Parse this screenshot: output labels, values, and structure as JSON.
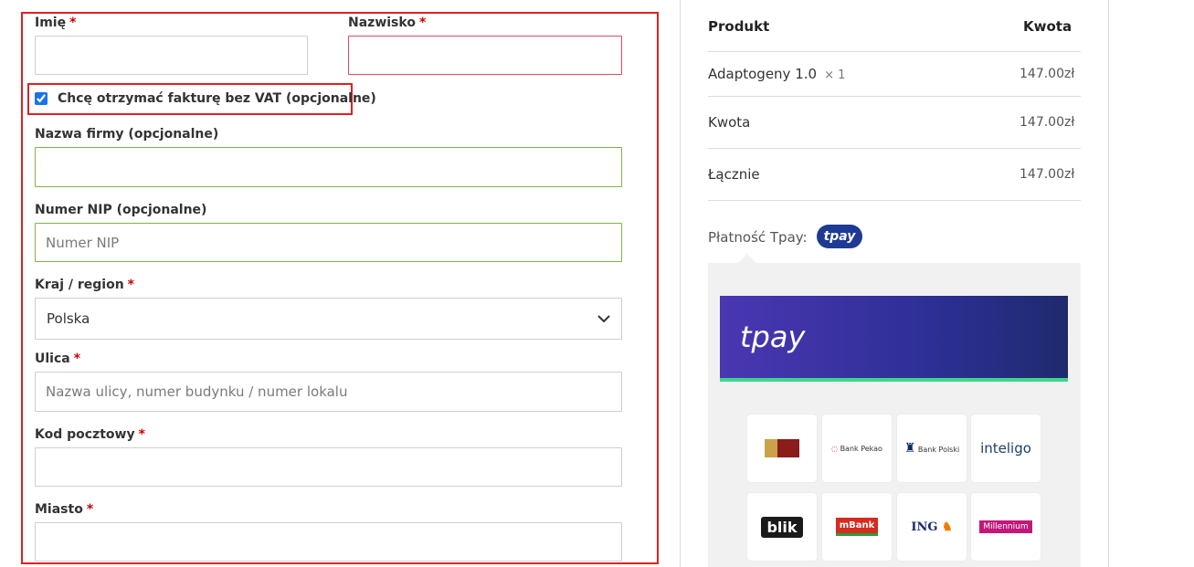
{
  "form": {
    "first_name_label": "Imię",
    "last_name_label": "Nazwisko",
    "required_mark": "*",
    "vat_checkbox_label": "Chcę otrzymać fakturę bez VAT (opcjonalne)",
    "company_label": "Nazwa firmy (opcjonalne)",
    "nip_label": "Numer NIP (opcjonalne)",
    "nip_placeholder": "Numer NIP",
    "country_label": "Kraj / region",
    "country_value": "Polska",
    "street_label": "Ulica",
    "street_placeholder": "Nazwa ulicy, numer budynku / numer lokalu",
    "postcode_label": "Kod pocztowy",
    "city_label": "Miasto"
  },
  "summary": {
    "col_product": "Produkt",
    "col_amount": "Kwota",
    "product_name": "Adaptogeny 1.0",
    "product_qty": "× 1",
    "product_price": "147.00zł",
    "subtotal_label": "Kwota",
    "subtotal_value": "147.00zł",
    "total_label": "Łącznie",
    "total_value": "147.00zł"
  },
  "payment": {
    "label": "Płatność Tpay:",
    "pill_logo": "tpay",
    "banner_logo": "tpay",
    "banks": [
      "Alior Bank",
      "Bank Pekao",
      "Bank Polski",
      "inteligo",
      "blik",
      "mBank",
      "ING",
      "Millennium"
    ]
  },
  "colors": {
    "error_border": "#d22222",
    "valid_border": "#7ab648",
    "tpay_blue": "#1f3a93",
    "tpay_green": "#3fd48e"
  }
}
